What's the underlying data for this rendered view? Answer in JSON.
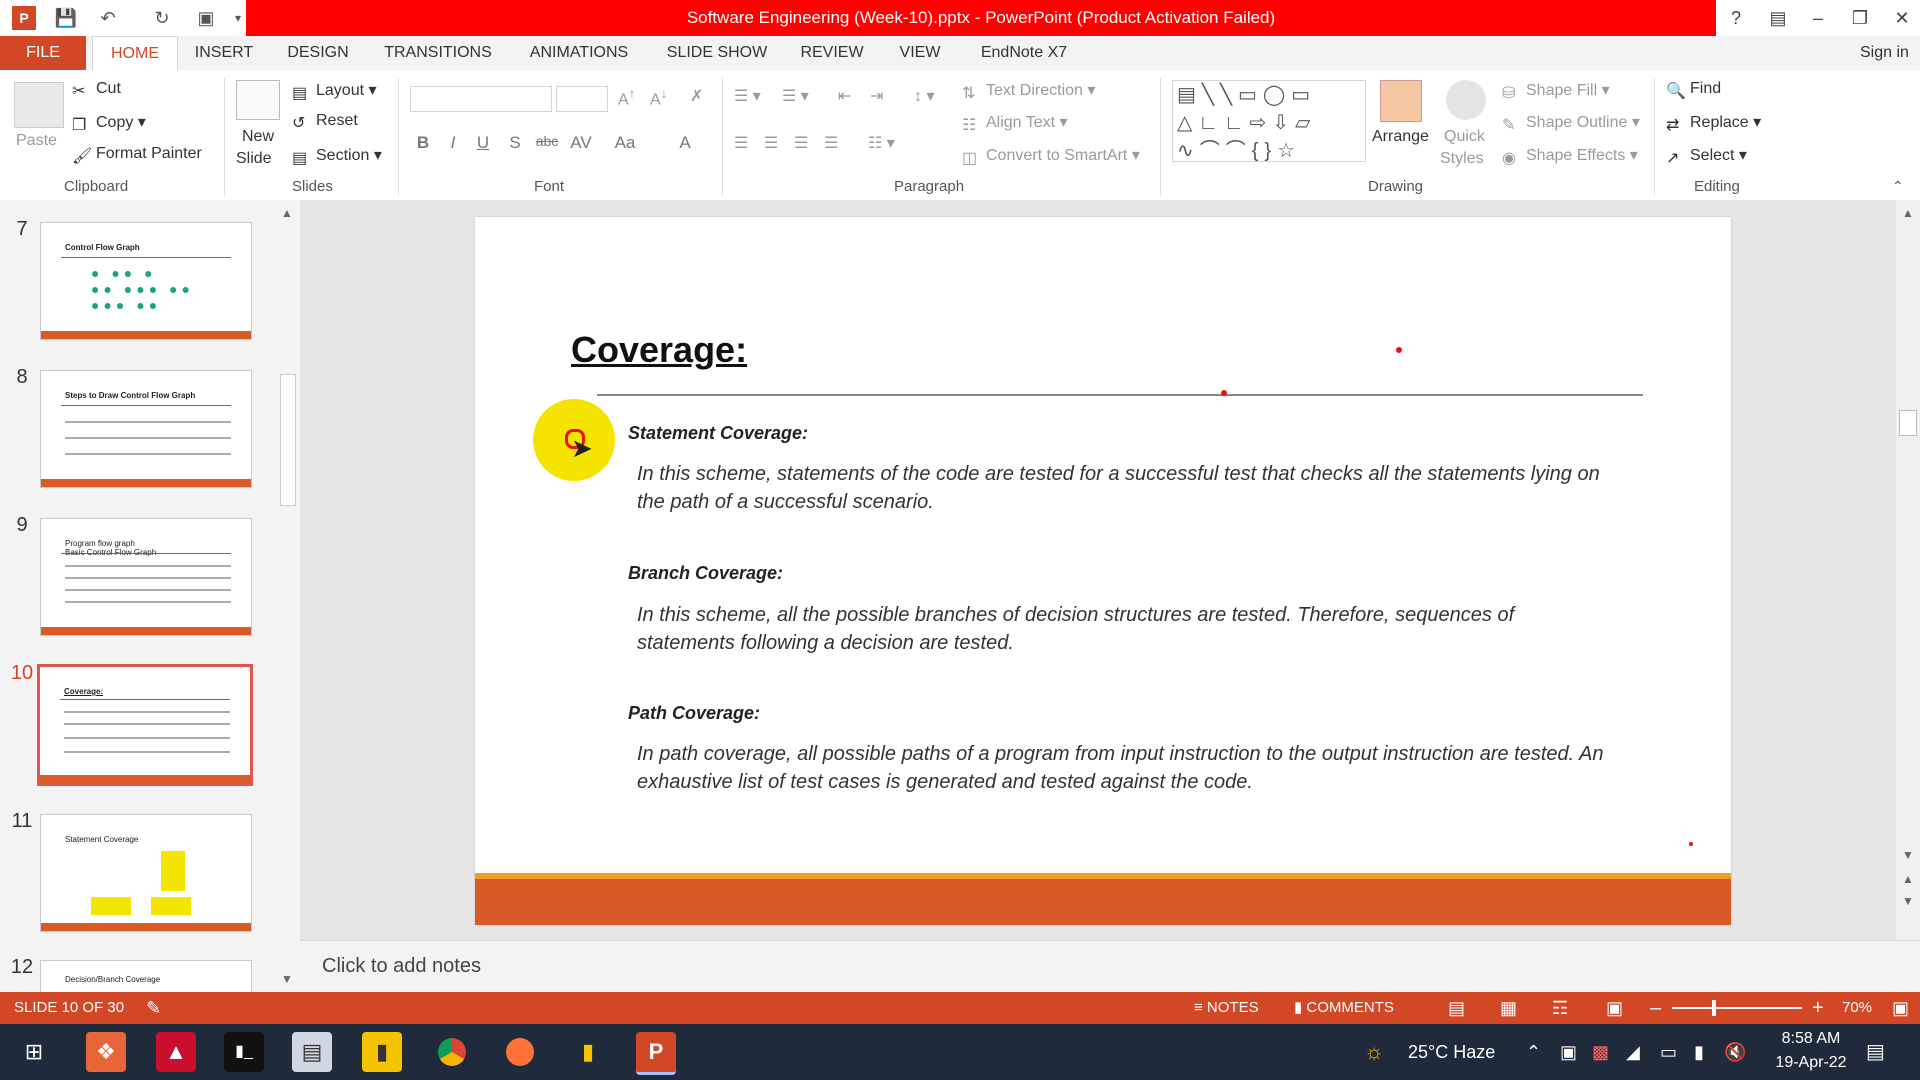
{
  "titlebar": {
    "title": "Software Engineering (Week-10).pptx - PowerPoint (Product Activation Failed)",
    "sign_in": "Sign in"
  },
  "tabs": [
    "FILE",
    "HOME",
    "INSERT",
    "DESIGN",
    "TRANSITIONS",
    "ANIMATIONS",
    "SLIDE SHOW",
    "REVIEW",
    "VIEW",
    "EndNote X7"
  ],
  "ribbon": {
    "clipboard": {
      "paste": "Paste",
      "cut": "Cut",
      "copy": "Copy",
      "format_painter": "Format Painter",
      "label": "Clipboard"
    },
    "slides": {
      "new_slide_1": "New",
      "new_slide_2": "Slide",
      "layout": "Layout",
      "reset": "Reset",
      "section": "Section",
      "label": "Slides"
    },
    "font": {
      "label": "Font",
      "bold": "B",
      "italic": "I",
      "underline": "U",
      "shadow": "S",
      "strike": "abc",
      "spacing": "AV",
      "case": "Aa",
      "color": "A"
    },
    "paragraph": {
      "text_direction": "Text Direction",
      "align_text": "Align Text",
      "convert": "Convert to SmartArt",
      "label": "Paragraph"
    },
    "drawing": {
      "arrange": "Arrange",
      "quick_1": "Quick",
      "quick_2": "Styles",
      "shape_fill": "Shape Fill",
      "shape_outline": "Shape Outline",
      "shape_effects": "Shape Effects",
      "label": "Drawing"
    },
    "editing": {
      "find": "Find",
      "replace": "Replace",
      "select": "Select",
      "label": "Editing"
    }
  },
  "thumbnails": [
    {
      "num": "7",
      "title": "Control Flow Graph"
    },
    {
      "num": "8",
      "title": "Steps to Draw Control Flow Graph"
    },
    {
      "num": "9",
      "title": "Program flow graph\nBasic Control Flow Graph"
    },
    {
      "num": "10",
      "title": "Coverage:"
    },
    {
      "num": "11",
      "title": "Statement Coverage"
    },
    {
      "num": "12",
      "title": "Decision/Branch Coverage"
    }
  ],
  "slide": {
    "title": "Coverage:",
    "sections": [
      {
        "heading": "Statement Coverage:",
        "text": "In this scheme, statements of the code are tested for a successful test that checks all the statements lying on the path of a successful scenario."
      },
      {
        "heading": "Branch Coverage:",
        "text": "In this scheme, all the possible branches of decision structures are tested. Therefore, sequences of statements following a decision are tested."
      },
      {
        "heading": "Path Coverage:",
        "text": "In path coverage, all possible paths of a program from input instruction to the output instruction are tested. An exhaustive list of test cases is generated and tested against the code."
      }
    ]
  },
  "notes_placeholder": "Click to add notes",
  "status": {
    "slide_info": "SLIDE 10 OF 30",
    "notes": "NOTES",
    "comments": "COMMENTS",
    "zoom": "70%"
  },
  "taskbar": {
    "weather": "25°C  Haze",
    "time": "8:58 AM",
    "date": "19-Apr-22"
  },
  "colors": {
    "accent": "#d24726",
    "title_red": "#ff0000",
    "slide_footer": "#d95a26",
    "cursor_highlight": "#f5e400"
  }
}
